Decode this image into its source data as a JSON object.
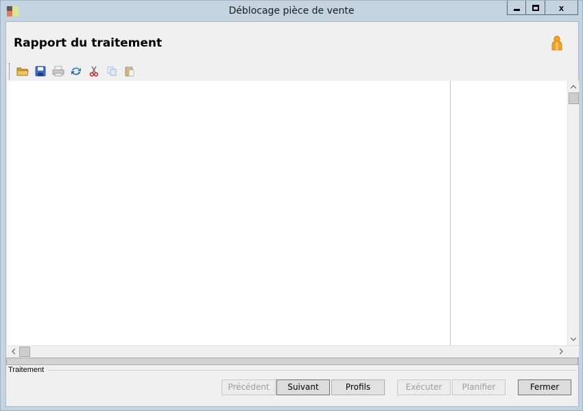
{
  "window": {
    "title": "Déblocage pièce de vente",
    "controls": {
      "minimize": "",
      "maximize": "",
      "close": "x"
    }
  },
  "header": {
    "title": "Rapport du traitement",
    "user_icon": "user-icon"
  },
  "toolbar": {
    "items": [
      {
        "name": "open-folder-icon",
        "enabled": true
      },
      {
        "name": "save-icon",
        "enabled": true
      },
      {
        "name": "print-icon",
        "enabled": false
      },
      {
        "name": "refresh-icon",
        "enabled": true
      },
      {
        "name": "cut-icon",
        "enabled": true
      },
      {
        "name": "copy-icon",
        "enabled": false
      },
      {
        "name": "paste-icon",
        "enabled": false
      }
    ]
  },
  "report": {
    "scroll_up": "^",
    "scroll_down": "v",
    "scroll_left": "<",
    "scroll_right": ">"
  },
  "section": {
    "label": "Traitement"
  },
  "buttons": {
    "previous": {
      "label": "Précédent",
      "enabled": false
    },
    "next": {
      "label": "Suivant",
      "enabled": true
    },
    "profiles": {
      "label": "Profils",
      "enabled": true
    },
    "execute": {
      "label": "Exécuter",
      "enabled": false
    },
    "schedule": {
      "label": "Planifier",
      "enabled": false
    },
    "close": {
      "label": "Fermer",
      "enabled": true
    }
  },
  "colors": {
    "frame": "#c3d3df",
    "client": "#f0f0f0",
    "accent_orange": "#f0a020",
    "accent_blue": "#2d6fc4"
  }
}
